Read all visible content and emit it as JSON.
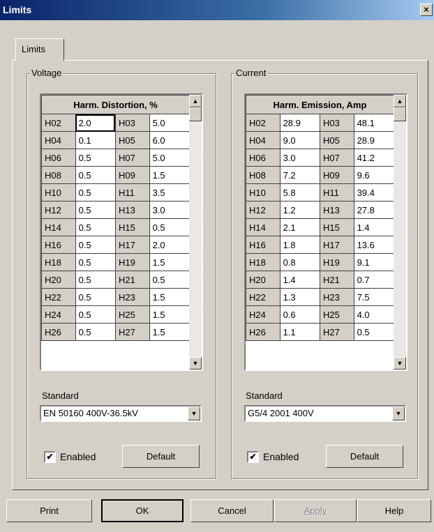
{
  "window": {
    "title": "Limits",
    "close_glyph": "×"
  },
  "tab": {
    "label": "Limits"
  },
  "voltage": {
    "group_label": "Voltage",
    "table_header": "Harm. Distortion, %",
    "rows": [
      [
        "H02",
        "2.0",
        "H03",
        "5.0"
      ],
      [
        "H04",
        "0.1",
        "H05",
        "6.0"
      ],
      [
        "H06",
        "0.5",
        "H07",
        "5.0"
      ],
      [
        "H08",
        "0.5",
        "H09",
        "1.5"
      ],
      [
        "H10",
        "0.5",
        "H11",
        "3.5"
      ],
      [
        "H12",
        "0.5",
        "H13",
        "3.0"
      ],
      [
        "H14",
        "0.5",
        "H15",
        "0.5"
      ],
      [
        "H16",
        "0.5",
        "H17",
        "2.0"
      ],
      [
        "H18",
        "0.5",
        "H19",
        "1.5"
      ],
      [
        "H20",
        "0.5",
        "H21",
        "0.5"
      ],
      [
        "H22",
        "0.5",
        "H23",
        "1.5"
      ],
      [
        "H24",
        "0.5",
        "H25",
        "1.5"
      ],
      [
        "H26",
        "0.5",
        "H27",
        "1.5"
      ]
    ],
    "standard_label": "Standard",
    "standard_value": "EN 50160 400V-36.5kV",
    "enabled_label": "Enabled",
    "enabled_checked": "✔",
    "default_button": "Default"
  },
  "current": {
    "group_label": "Current",
    "table_header": "Harm. Emission, Amp",
    "rows": [
      [
        "H02",
        "28.9",
        "H03",
        "48.1"
      ],
      [
        "H04",
        "9.0",
        "H05",
        "28.9"
      ],
      [
        "H06",
        "3.0",
        "H07",
        "41.2"
      ],
      [
        "H08",
        "7.2",
        "H09",
        "9.6"
      ],
      [
        "H10",
        "5.8",
        "H11",
        "39.4"
      ],
      [
        "H12",
        "1.2",
        "H13",
        "27.8"
      ],
      [
        "H14",
        "2.1",
        "H15",
        "1.4"
      ],
      [
        "H16",
        "1.8",
        "H17",
        "13.6"
      ],
      [
        "H18",
        "0.8",
        "H19",
        "9.1"
      ],
      [
        "H20",
        "1.4",
        "H21",
        "0.7"
      ],
      [
        "H22",
        "1.3",
        "H23",
        "7.5"
      ],
      [
        "H24",
        "0.6",
        "H25",
        "4.0"
      ],
      [
        "H26",
        "1.1",
        "H27",
        "0.5"
      ]
    ],
    "standard_label": "Standard",
    "standard_value": "G5/4 2001 400V",
    "enabled_label": "Enabled",
    "enabled_checked": "✔",
    "default_button": "Default"
  },
  "icons": {
    "scroll_up": "▲",
    "scroll_down": "▼",
    "dropdown": "▼"
  },
  "footer": {
    "print": "Print",
    "ok": "OK",
    "cancel": "Cancel",
    "apply": "Apply",
    "help": "Help"
  }
}
